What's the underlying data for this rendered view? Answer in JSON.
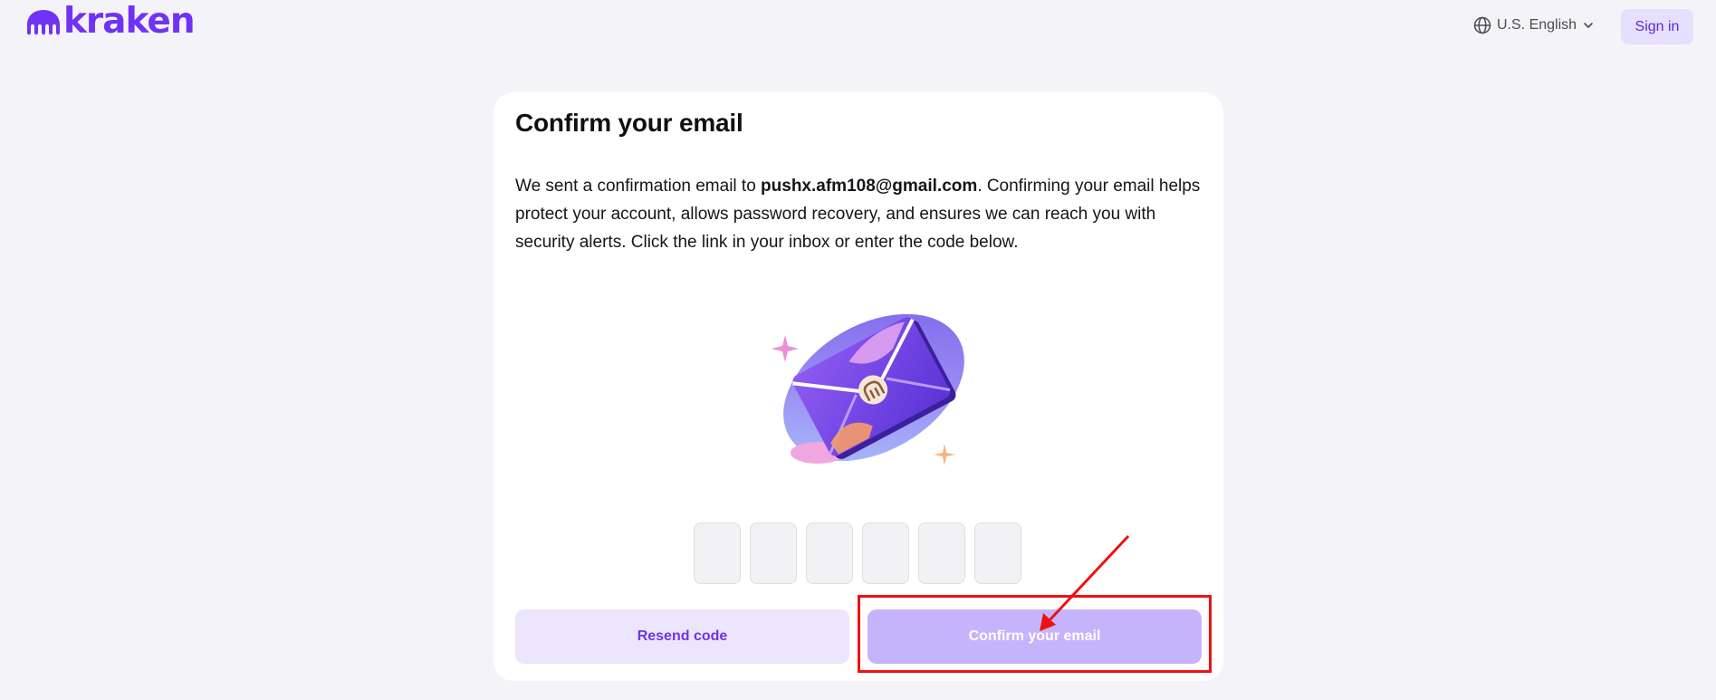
{
  "header": {
    "logo_text": "kraken",
    "language": "U.S. English",
    "signin_label": "Sign in"
  },
  "card": {
    "title": "Confirm your email",
    "desc_prefix": "We sent a confirmation email to ",
    "email": "pushx.afm108@gmail.com",
    "desc_suffix": ". Confirming your email helps protect your account, allows password recovery, and ensures we can reach you with security alerts. Click the link in your inbox or enter the code below.",
    "code_digits": [
      "",
      "",
      "",
      "",
      "",
      ""
    ],
    "resend_label": "Resend code",
    "confirm_label": "Confirm your email"
  },
  "colors": {
    "brand": "#7132f5",
    "confirm_disabled": "#c5b4fb",
    "resend_bg": "#ebe6fe",
    "annotation": "#ee1111"
  },
  "icons": {
    "logo": "kraken-logo-icon",
    "language": "globe-icon",
    "dropdown": "chevron-down-icon",
    "illustration": "envelope-illustration"
  }
}
